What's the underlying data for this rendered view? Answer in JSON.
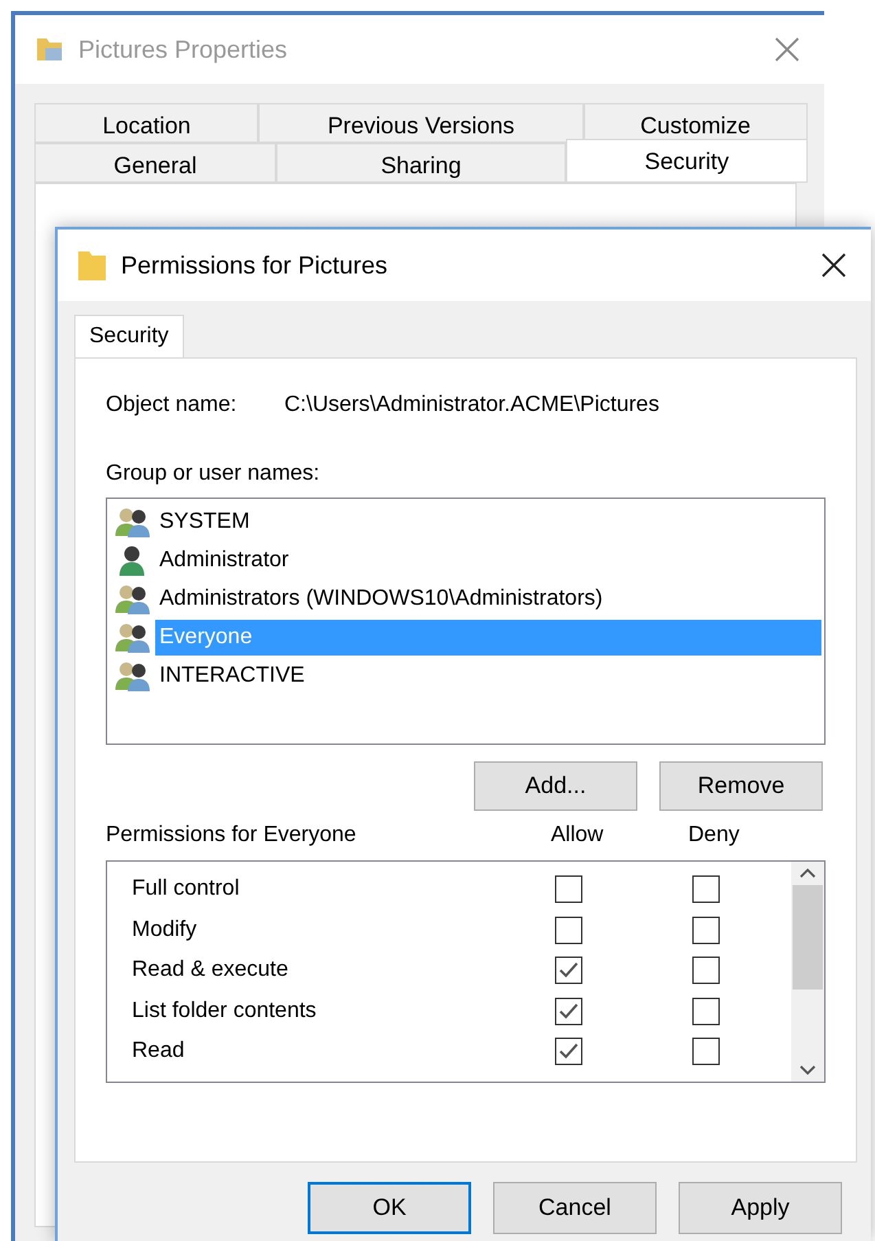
{
  "back_window": {
    "title": "Pictures Properties",
    "tab_rows": [
      [
        {
          "label": "Location",
          "selected": false
        },
        {
          "label": "Previous Versions",
          "selected": false
        },
        {
          "label": "Customize",
          "selected": false
        }
      ],
      [
        {
          "label": "General",
          "selected": false
        },
        {
          "label": "Sharing",
          "selected": false
        },
        {
          "label": "Security",
          "selected": true
        }
      ]
    ]
  },
  "dialog": {
    "title": "Permissions for Pictures",
    "tabs": [
      {
        "label": "Security",
        "selected": true
      }
    ],
    "object_name": {
      "label": "Object name:",
      "value": "C:\\Users\\Administrator.ACME\\Pictures"
    },
    "group_label": "Group or user names:",
    "users": [
      {
        "name": "SYSTEM",
        "kind": "group",
        "selected": false
      },
      {
        "name": "Administrator",
        "kind": "user",
        "selected": false
      },
      {
        "name": "Administrators (WINDOWS10\\Administrators)",
        "kind": "group",
        "selected": false
      },
      {
        "name": "Everyone",
        "kind": "group",
        "selected": true
      },
      {
        "name": "INTERACTIVE",
        "kind": "group",
        "selected": false
      }
    ],
    "user_buttons": [
      "Add...",
      "Remove"
    ],
    "permissions_label": "Permissions for Everyone",
    "columns": [
      "Allow",
      "Deny"
    ],
    "permissions": [
      {
        "name": "Full control",
        "allow": false,
        "deny": false
      },
      {
        "name": "Modify",
        "allow": false,
        "deny": false
      },
      {
        "name": "Read & execute",
        "allow": true,
        "deny": false
      },
      {
        "name": "List folder contents",
        "allow": true,
        "deny": false
      },
      {
        "name": "Read",
        "allow": true,
        "deny": false
      }
    ],
    "buttons": [
      {
        "label": "OK",
        "default": true
      },
      {
        "label": "Cancel",
        "default": false
      },
      {
        "label": "Apply",
        "default": false
      }
    ]
  }
}
